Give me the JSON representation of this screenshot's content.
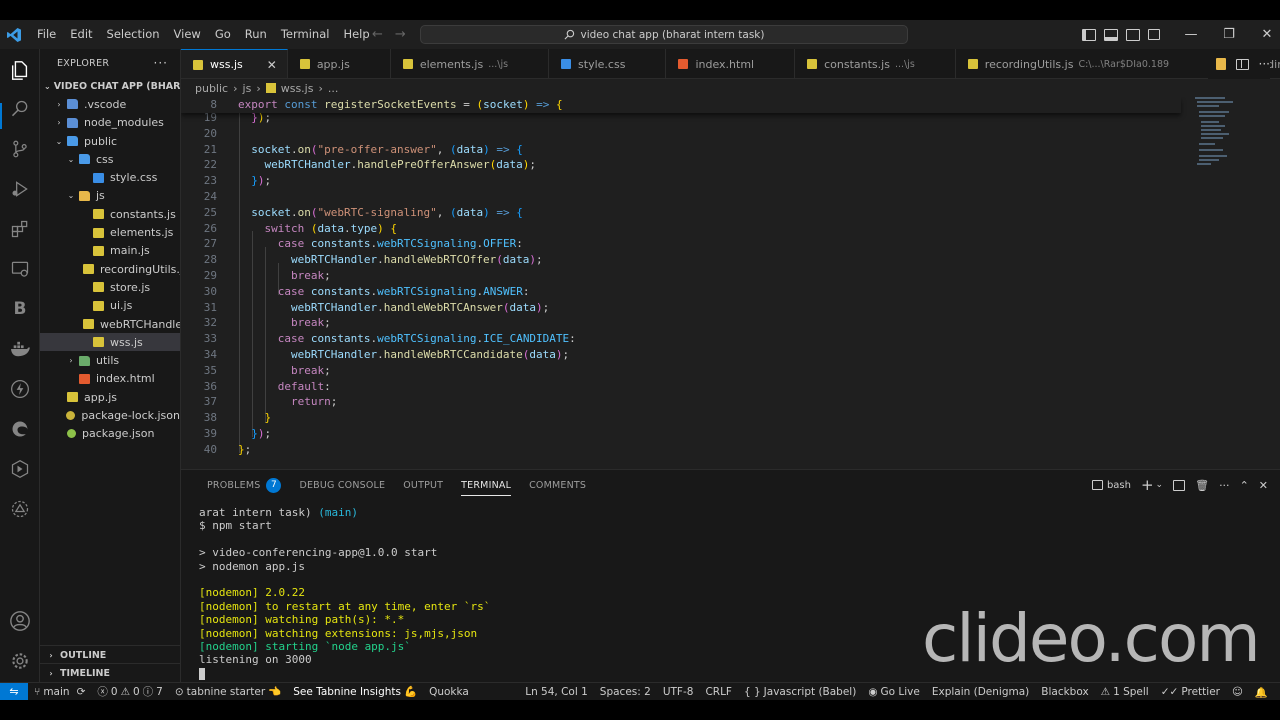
{
  "menu": [
    "File",
    "Edit",
    "Selection",
    "View",
    "Go",
    "Run",
    "Terminal",
    "Help"
  ],
  "command_center": "video chat app (bharat intern task)",
  "explorer": {
    "title": "EXPLORER",
    "root": "VIDEO CHAT APP (BHARA...",
    "items": [
      {
        "label": ".vscode",
        "depth": 1,
        "type": "folder",
        "chev": "›"
      },
      {
        "label": "node_modules",
        "depth": 1,
        "type": "folder",
        "chev": "›"
      },
      {
        "label": "public",
        "depth": 1,
        "type": "folder",
        "chev": "⌄"
      },
      {
        "label": "css",
        "depth": 2,
        "type": "folder",
        "chev": "⌄"
      },
      {
        "label": "style.css",
        "depth": 3,
        "type": "css"
      },
      {
        "label": "js",
        "depth": 2,
        "type": "folder",
        "chev": "⌄"
      },
      {
        "label": "constants.js",
        "depth": 3,
        "type": "js"
      },
      {
        "label": "elements.js",
        "depth": 3,
        "type": "js"
      },
      {
        "label": "main.js",
        "depth": 3,
        "type": "js"
      },
      {
        "label": "recordingUtils.js",
        "depth": 3,
        "type": "js"
      },
      {
        "label": "store.js",
        "depth": 3,
        "type": "js"
      },
      {
        "label": "ui.js",
        "depth": 3,
        "type": "js"
      },
      {
        "label": "webRTCHandle...",
        "depth": 3,
        "type": "js"
      },
      {
        "label": "wss.js",
        "depth": 3,
        "type": "js",
        "selected": true
      },
      {
        "label": "utils",
        "depth": 2,
        "type": "folder",
        "chev": "›"
      },
      {
        "label": "index.html",
        "depth": 2,
        "type": "html"
      },
      {
        "label": "app.js",
        "depth": 1,
        "type": "js"
      },
      {
        "label": "package-lock.json",
        "depth": 1,
        "type": "json"
      },
      {
        "label": "package.json",
        "depth": 1,
        "type": "json"
      }
    ],
    "outline": "OUTLINE",
    "timeline": "TIMELINE"
  },
  "tabs": [
    {
      "label": "wss.js",
      "icon": "js",
      "active": true,
      "hint": ""
    },
    {
      "label": "app.js",
      "icon": "js",
      "hint": ""
    },
    {
      "label": "elements.js",
      "icon": "js",
      "hint": "...\\js"
    },
    {
      "label": "style.css",
      "icon": "css",
      "hint": ""
    },
    {
      "label": "index.html",
      "icon": "html",
      "hint": ""
    },
    {
      "label": "constants.js",
      "icon": "js",
      "hint": "...\\js"
    },
    {
      "label": "recordingUtils.js",
      "icon": "js",
      "hint": "C:\\...\\Rar$DIa0.189"
    },
    {
      "label": "recordingUtils.js",
      "icon": "js",
      "hint": "...\\js"
    }
  ],
  "breadcrumb": [
    "public",
    "js",
    "wss.js",
    "..."
  ],
  "code": {
    "sticky": {
      "num": "8",
      "html": "<span class='kw'>export</span> <span class='k'>const</span> <span class='f'>registerSocketEvents</span> = <span class='y'>(</span><span class='v'>socket</span><span class='y'>)</span> <span class='k'>=&gt;</span> <span class='y'>{</span>"
    },
    "lines": [
      {
        "num": "19",
        "html": "  <span class='p'>}</span><span class='y'>)</span>;"
      },
      {
        "num": "20",
        "html": ""
      },
      {
        "num": "21",
        "html": "  <span class='v'>socket</span>.<span class='f'>on</span><span class='p'>(</span><span class='s'>\"pre-offer-answer\"</span>, <span class='b'>(</span><span class='v'>data</span><span class='b'>)</span> <span class='k'>=&gt;</span> <span class='b'>{</span>"
      },
      {
        "num": "22",
        "html": "    <span class='v'>webRTCHandler</span>.<span class='f'>handlePreOfferAnswer</span><span class='y'>(</span><span class='v'>data</span><span class='y'>)</span>;"
      },
      {
        "num": "23",
        "html": "  <span class='b'>}</span><span class='p'>)</span>;"
      },
      {
        "num": "24",
        "html": ""
      },
      {
        "num": "25",
        "html": "  <span class='v'>socket</span>.<span class='f'>on</span><span class='p'>(</span><span class='s'>\"webRTC-signaling\"</span>, <span class='b'>(</span><span class='v'>data</span><span class='b'>)</span> <span class='k'>=&gt;</span> <span class='b'>{</span>"
      },
      {
        "num": "26",
        "html": "    <span class='kw'>switch</span> <span class='y'>(</span><span class='v'>data</span>.<span class='v'>type</span><span class='y'>)</span> <span class='y'>{</span>"
      },
      {
        "num": "27",
        "html": "      <span class='kw'>case</span> <span class='v'>constants</span>.<span class='c'>webRTCSignaling</span>.<span class='c'>OFFER</span>:"
      },
      {
        "num": "28",
        "html": "        <span class='v'>webRTCHandler</span>.<span class='f'>handleWebRTCOffer</span><span class='p'>(</span><span class='v'>data</span><span class='p'>)</span>;"
      },
      {
        "num": "29",
        "html": "        <span class='kw'>break</span>;"
      },
      {
        "num": "30",
        "html": "      <span class='kw'>case</span> <span class='v'>constants</span>.<span class='c'>webRTCSignaling</span>.<span class='c'>ANSWER</span>:"
      },
      {
        "num": "31",
        "html": "        <span class='v'>webRTCHandler</span>.<span class='f'>handleWebRTCAnswer</span><span class='p'>(</span><span class='v'>data</span><span class='p'>)</span>;"
      },
      {
        "num": "32",
        "html": "        <span class='kw'>break</span>;"
      },
      {
        "num": "33",
        "html": "      <span class='kw'>case</span> <span class='v'>constants</span>.<span class='c'>webRTCSignaling</span>.<span class='c'>ICE_CANDIDATE</span>:"
      },
      {
        "num": "34",
        "html": "        <span class='v'>webRTCHandler</span>.<span class='f'>handleWebRTCCandidate</span><span class='p'>(</span><span class='v'>data</span><span class='p'>)</span>;"
      },
      {
        "num": "35",
        "html": "        <span class='kw'>break</span>;"
      },
      {
        "num": "36",
        "html": "      <span class='kw'>default</span>:"
      },
      {
        "num": "37",
        "html": "        <span class='kw'>return</span>;"
      },
      {
        "num": "38",
        "html": "    <span class='y'>}</span>"
      },
      {
        "num": "39",
        "html": "  <span class='b'>}</span><span class='p'>)</span>;"
      },
      {
        "num": "40",
        "html": "<span class='y'>}</span>;"
      }
    ]
  },
  "panel": {
    "tabs": [
      "PROBLEMS",
      "DEBUG CONSOLE",
      "OUTPUT",
      "TERMINAL",
      "COMMENTS"
    ],
    "problems_count": "7",
    "active_tab": "TERMINAL",
    "shell": "bash"
  },
  "terminal_lines": [
    {
      "cls": "",
      "html": "arat intern task) <span class='t-cyan'>(main)</span>"
    },
    {
      "cls": "",
      "html": "$ npm start"
    },
    {
      "cls": "",
      "html": ""
    },
    {
      "cls": "",
      "html": "&gt; video-conferencing-app@1.0.0 start"
    },
    {
      "cls": "",
      "html": "&gt; nodemon app.js"
    },
    {
      "cls": "",
      "html": ""
    },
    {
      "cls": "t-yellow",
      "html": "[nodemon] 2.0.22"
    },
    {
      "cls": "t-yellow",
      "html": "[nodemon] to restart at any time, enter `rs`"
    },
    {
      "cls": "t-yellow",
      "html": "[nodemon] watching path(s): *.*"
    },
    {
      "cls": "t-yellow",
      "html": "[nodemon] watching extensions: js,mjs,json"
    },
    {
      "cls": "t-green",
      "html": "[nodemon] starting `node app.js`"
    },
    {
      "cls": "",
      "html": "listening on 3000"
    }
  ],
  "watermark": "clideo.com",
  "status": {
    "branch": "main",
    "errors": "0",
    "warnings": "0",
    "info": "7",
    "tabnine": "tabnine starter",
    "tabnine_insights": "See Tabnine Insights",
    "quokka": "Quokka",
    "position": "Ln 54, Col 1",
    "spaces": "Spaces: 2",
    "encoding": "UTF-8",
    "eol": "CRLF",
    "language": "Javascript (Babel)",
    "golive": "Go Live",
    "explain": "Explain (Denigma)",
    "blackbox": "Blackbox",
    "spell": "1 Spell",
    "prettier": "Prettier"
  }
}
